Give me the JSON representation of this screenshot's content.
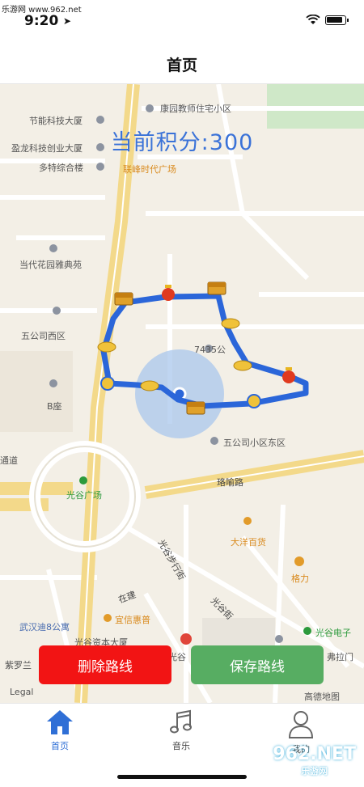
{
  "watermark": {
    "top": "乐游网 www.962.net",
    "bottom_brand": "962.NET",
    "bottom_cn": "乐游网"
  },
  "status_bar": {
    "time": "9:20"
  },
  "nav": {
    "title": "首页"
  },
  "score_text": "当前积分:300",
  "map": {
    "pois": [
      {
        "id": "p1",
        "text": "康园教师住宅小区",
        "color": "grey"
      },
      {
        "id": "p2",
        "text": "节能科技大厦",
        "color": "grey"
      },
      {
        "id": "p3",
        "text": "盈龙科技创业大厦",
        "color": "grey"
      },
      {
        "id": "p4",
        "text": "多特综合楼",
        "color": "grey"
      },
      {
        "id": "p5",
        "text": "联峰时代广场",
        "color": "orange"
      },
      {
        "id": "p6",
        "text": "当代花园雅典苑",
        "color": "grey"
      },
      {
        "id": "p7",
        "text": "五公司西区",
        "color": "grey"
      },
      {
        "id": "p8",
        "text": "7435公",
        "color": "grey"
      },
      {
        "id": "p9",
        "text": "B座",
        "color": "grey"
      },
      {
        "id": "p10",
        "text": "五公司小区东区",
        "color": "grey"
      },
      {
        "id": "p11",
        "text": "光谷广场",
        "color": "green"
      },
      {
        "id": "p12",
        "text": "大洋百货",
        "color": "orange"
      },
      {
        "id": "p13",
        "text": "格力",
        "color": "orange"
      },
      {
        "id": "p14",
        "text": "宜信惠普",
        "color": "orange"
      },
      {
        "id": "p15",
        "text": "武汉迪8公寓",
        "color": "blue"
      },
      {
        "id": "p16",
        "text": "光谷资本大厦",
        "color": "grey"
      },
      {
        "id": "p17",
        "text": "光谷电子",
        "color": "green"
      },
      {
        "id": "p18",
        "text": "弗拉门",
        "color": "grey"
      },
      {
        "id": "p19",
        "text": "紫罗兰",
        "color": "grey"
      },
      {
        "id": "p20",
        "text": "通道",
        "color": "grey"
      },
      {
        "id": "p21",
        "text": "光谷",
        "color": "grey"
      }
    ],
    "roads": [
      {
        "id": "r1",
        "text": "珞喻路"
      },
      {
        "id": "r2",
        "text": "光谷步行街"
      },
      {
        "id": "r3",
        "text": "光谷街"
      },
      {
        "id": "r4",
        "text": "在建"
      }
    ],
    "legal": "Legal",
    "provider": "高德地图"
  },
  "buttons": {
    "delete": "删除路线",
    "save": "保存路线"
  },
  "tabs": [
    {
      "label": "首页",
      "icon": "home-icon",
      "active": true
    },
    {
      "label": "音乐",
      "icon": "music-icon",
      "active": false
    },
    {
      "label": "我的",
      "icon": "profile-icon",
      "active": false
    }
  ],
  "colors": {
    "route": "#2b66d9",
    "accent": "#2f6fd6",
    "delete": "#f21414",
    "save": "#57ad62"
  }
}
